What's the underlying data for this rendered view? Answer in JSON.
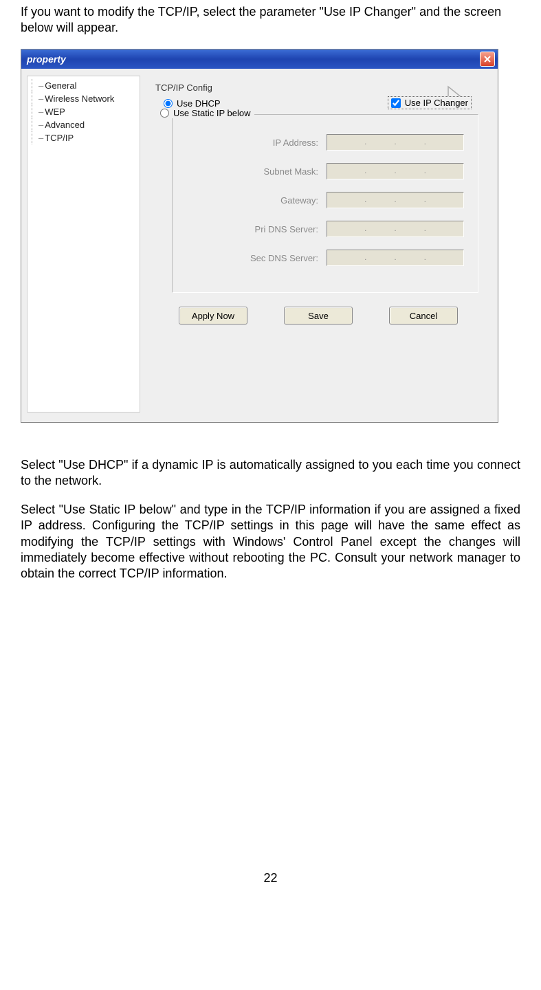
{
  "intro": "If you want to modify the TCP/IP, select the parameter \"Use IP Changer\" and the screen below will appear.",
  "window": {
    "title": "property",
    "sidebar": {
      "items": [
        "General",
        "Wireless Network",
        "WEP",
        "Advanced",
        "TCP/IP"
      ]
    },
    "section_title": "TCP/IP Config",
    "use_ip_changer": {
      "label": "Use IP Changer",
      "checked": true
    },
    "radio_dhcp": {
      "label": "Use DHCP",
      "selected": true
    },
    "radio_static": {
      "label": "Use Static IP below",
      "selected": false
    },
    "fields": [
      {
        "label": "IP Address:"
      },
      {
        "label": "Subnet Mask:"
      },
      {
        "label": "Gateway:"
      },
      {
        "label": "Pri DNS Server:"
      },
      {
        "label": "Sec DNS Server:"
      }
    ],
    "buttons": {
      "apply": "Apply Now",
      "save": "Save",
      "cancel": "Cancel"
    }
  },
  "para_dhcp": "Select \"Use DHCP\" if a dynamic IP is automatically assigned to you each time you connect to the network.",
  "para_static": "Select \"Use Static IP below\" and type in the TCP/IP information if you are assigned a fixed IP address. Configuring the TCP/IP settings in this page will have the same effect as modifying the TCP/IP settings with Windows' Control Panel except the changes will immediately become effective without rebooting the PC. Consult your network manager to obtain the correct TCP/IP information.",
  "page_number": "22"
}
